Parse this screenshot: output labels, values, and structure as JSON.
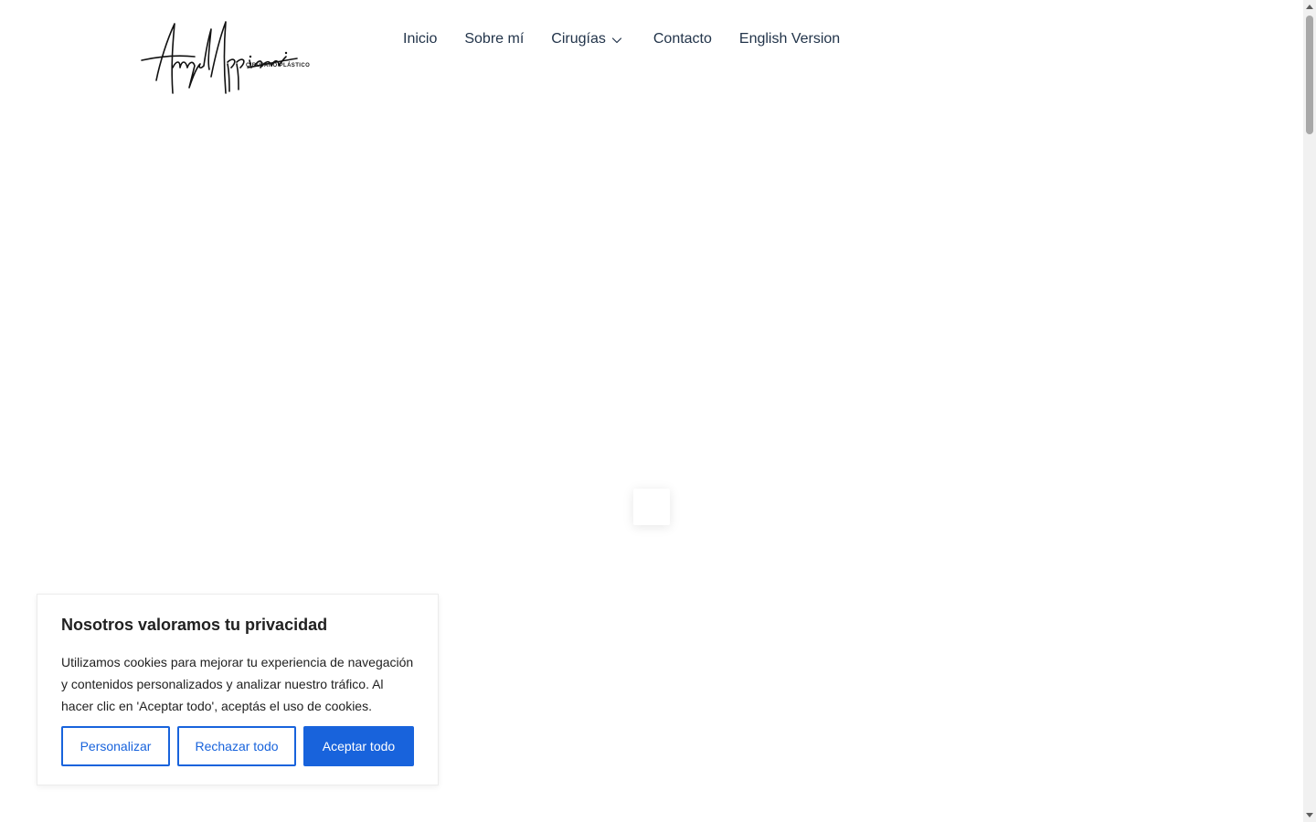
{
  "header": {
    "logo": {
      "name": "Angel Appiani",
      "subtitle": "CIRUJANO PLÁSTICO"
    },
    "nav": [
      {
        "label": "Inicio"
      },
      {
        "label": "Sobre mí"
      },
      {
        "label": "Cirugías",
        "dropdown": true
      },
      {
        "label": "Contacto"
      },
      {
        "label": "English Version"
      }
    ]
  },
  "cookie_banner": {
    "title": "Nosotros valoramos tu privacidad",
    "text": "Utilizamos cookies para mejorar tu experiencia de navegación y contenidos personalizados y analizar nuestro tráfico. Al hacer clic en 'Aceptar todo', aceptás el uso de cookies.",
    "buttons": {
      "customize": "Personalizar",
      "reject": "Rechazar todo",
      "accept": "Aceptar todo"
    }
  },
  "colors": {
    "accent": "#1863dc",
    "nav_text": "#22344a",
    "text": "#212121"
  },
  "icons": {
    "dropdown": "chevron-down-icon"
  }
}
